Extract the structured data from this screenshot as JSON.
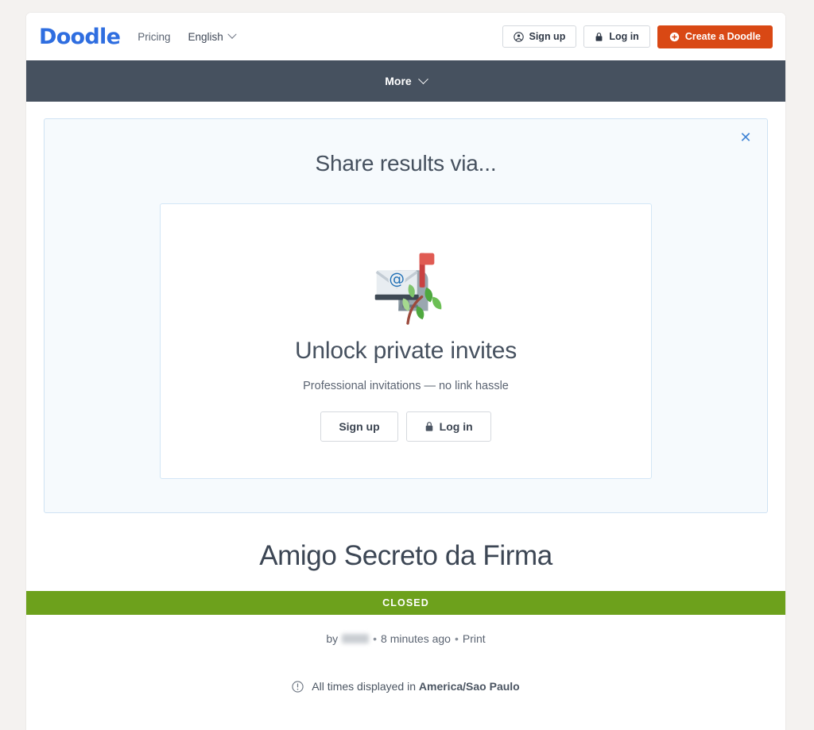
{
  "header": {
    "brand": "Doodle",
    "nav": [
      {
        "label": "Pricing",
        "name": "nav-pricing"
      }
    ],
    "language": {
      "label": "English",
      "icon": "chevron-down-icon"
    },
    "actions": [
      {
        "label": "Sign up",
        "icon": "user-circle-icon",
        "style": "secondary"
      },
      {
        "label": "Log in",
        "icon": "lock-icon",
        "style": "secondary"
      },
      {
        "label": "Create a Doodle",
        "icon": "plus-circle-icon",
        "style": "primary"
      }
    ]
  },
  "subnav": {
    "more_label": "More",
    "more_icon": "chevron-down-icon",
    "background": "#46515f"
  },
  "share_panel": {
    "title": "Share results via...",
    "close_icon": "close-icon",
    "background": "#f6fafd",
    "border": "#cfe2f3",
    "unlock_card": {
      "illustration": "mailbox-with-mail-icon",
      "title": "Unlock private invites",
      "subtitle": "Professional invitations — no link hassle",
      "buttons": [
        {
          "label": "Sign up",
          "icon": "none"
        },
        {
          "label": "Log in",
          "icon": "lock-icon"
        }
      ]
    }
  },
  "poll": {
    "title": "Amigo Secreto da Firma",
    "status": "CLOSED",
    "status_color": "#6da11c",
    "byline": {
      "by_label": "by",
      "author": "",
      "author_redacted": true,
      "separator": "•",
      "time": "8 minutes ago",
      "print_label": "Print"
    },
    "timezone_note": {
      "icon": "info-circle-icon",
      "prefix": "All times displayed in ",
      "zone": "America/Sao Paulo"
    }
  },
  "colors": {
    "brand_blue": "#2f6ee0",
    "accent_red": "#d94814",
    "dark_bar": "#46515f",
    "status_green": "#6da11c",
    "page_bg": "#f4f2f0",
    "link_blue": "#4285d6"
  }
}
